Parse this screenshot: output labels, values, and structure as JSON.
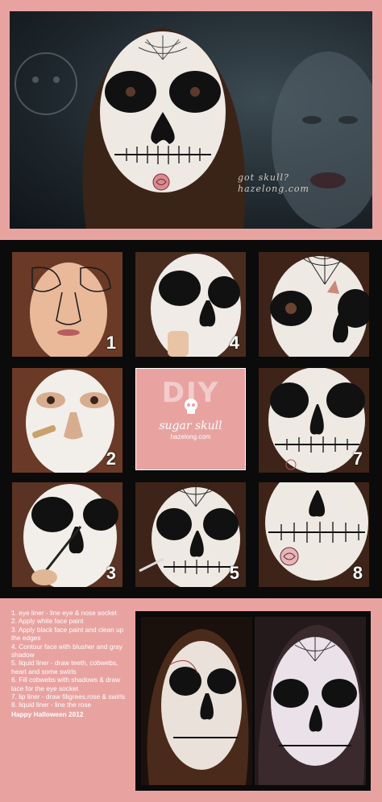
{
  "hero": {
    "signature_line1": "got skull?",
    "signature_line2": "hazelong.com"
  },
  "tiles": [
    {
      "number": "1"
    },
    {
      "number": "4"
    },
    {
      "number": "2"
    },
    {
      "number": "7"
    },
    {
      "number": "3"
    },
    {
      "number": "5"
    },
    {
      "number": "8"
    }
  ],
  "center_card": {
    "title": "DIY",
    "script": "sugar skull",
    "site": "hazelong.com"
  },
  "steps": [
    "1. eye liner - line eye & nose socket",
    "2. Apply white face paint",
    "3. Apply black face paint and clean up the edges",
    "4. Contour face with blusher and gray shadow",
    "5. liquid liner - draw teeth, cobwebs, heart and some swirls",
    "6. Fill cobwebs with shadows & draw lace for the eye socket",
    "7. lip liner - draw filigrees,rose & swirls",
    "8. liquid liner - line the rose"
  ],
  "footer_text": "Happy Halloween 2012",
  "colors": {
    "background_pink": "#e8a3a1",
    "band_black": "#0b0b0b",
    "face_paint_white": "#f2eeea",
    "black_paint": "#111111"
  }
}
